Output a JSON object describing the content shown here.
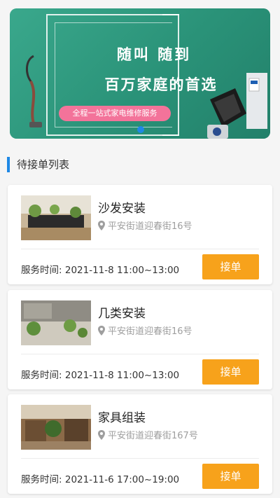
{
  "banner": {
    "headline1": "随叫 随到",
    "headline2": "百万家庭的首选",
    "tagline": "全程一站式家电维修服务"
  },
  "section": {
    "title": "待接单列表"
  },
  "orders": [
    {
      "title": "沙发安装",
      "address": "平安街道迎春街16号",
      "time_label": "服务时间:",
      "time": "2021-11-8 11:00~13:00",
      "button": "接单"
    },
    {
      "title": "几类安装",
      "address": "平安街道迎春街16号",
      "time_label": "服务时间:",
      "time": "2021-11-8 11:00~13:00",
      "button": "接单"
    },
    {
      "title": "家具组装",
      "address": "平安街道迎春街167号",
      "time_label": "服务时间:",
      "time": "2021-11-6 17:00~19:00",
      "button": "接单"
    }
  ],
  "colors": {
    "accent": "#1e88e5",
    "button": "#f7a21b",
    "banner": "#2e9a7f",
    "pill": "#f3739a"
  }
}
